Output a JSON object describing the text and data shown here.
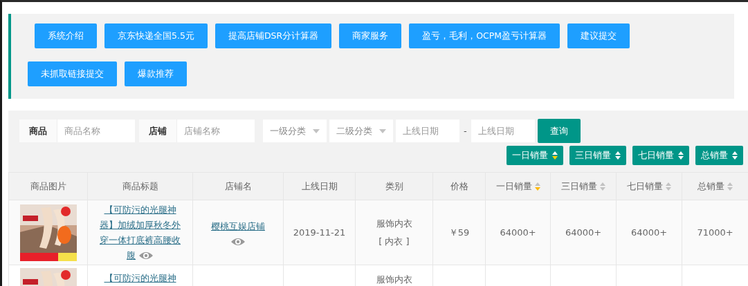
{
  "nav_buttons": [
    "系统介绍",
    "京东快递全国5.5元",
    "提高店铺DSR分计算器",
    "商家服务",
    "盈亏，毛利，OCPM盈亏计算器",
    "建议提交",
    "未抓取链接提交",
    "爆款推荐"
  ],
  "filters": {
    "product": {
      "label": "商品",
      "placeholder": "商品名称"
    },
    "shop": {
      "label": "店铺",
      "placeholder": "店铺名称"
    },
    "category_1": {
      "placeholder": "一级分类"
    },
    "category_2": {
      "placeholder": "二级分类"
    },
    "date_from": {
      "placeholder": "上线日期"
    },
    "date_separator": "-",
    "date_to": {
      "placeholder": "上线日期"
    },
    "search_button": "查询"
  },
  "sort_buttons": [
    {
      "label": "一日销量",
      "selected": true
    },
    {
      "label": "三日销量",
      "selected": false
    },
    {
      "label": "七日销量",
      "selected": false
    },
    {
      "label": "总销量",
      "selected": false
    }
  ],
  "table": {
    "columns": [
      {
        "label": "商品图片"
      },
      {
        "label": "商品标题"
      },
      {
        "label": "店铺名"
      },
      {
        "label": "上线日期"
      },
      {
        "label": "类别"
      },
      {
        "label": "价格"
      },
      {
        "label": "一日销量",
        "sortable": true,
        "selected": true
      },
      {
        "label": "三日销量",
        "sortable": true,
        "selected": false
      },
      {
        "label": "七日销量",
        "sortable": true,
        "selected": false
      },
      {
        "label": "总销量",
        "sortable": true,
        "selected": false
      }
    ],
    "rows": [
      {
        "title": "【可防污的光腿神器】加绒加厚秋冬外穿一体打底裤高腰收腹",
        "shop": "樱桃互娱店铺",
        "date": "2019-11-21",
        "category": "服饰内衣",
        "subcategory": "[ 内衣 ]",
        "price": "￥59",
        "sales_1d": "64000+",
        "sales_3d": "64000+",
        "sales_7d": "64000+",
        "sales_total": "71000+"
      },
      {
        "title": "【可防污的光腿神",
        "category": "服饰内衣"
      }
    ]
  }
}
